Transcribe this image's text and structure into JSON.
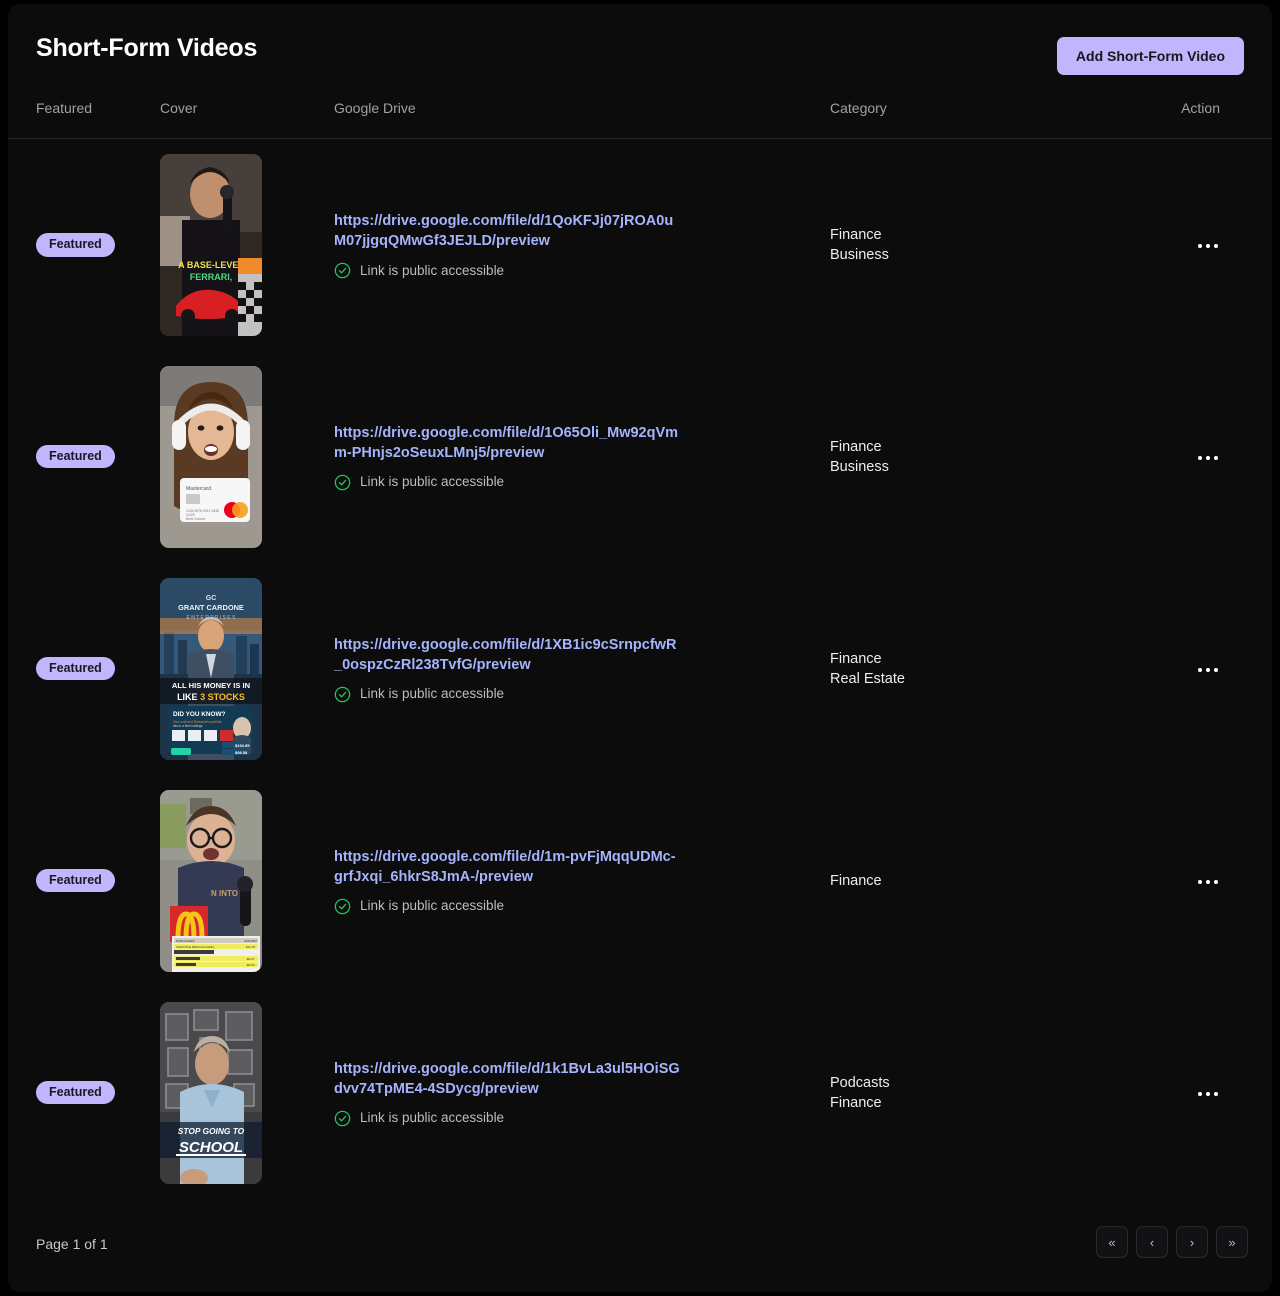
{
  "header": {
    "title": "Short-Form Videos",
    "add_button_label": "Add Short-Form Video"
  },
  "table": {
    "columns": {
      "featured": "Featured",
      "cover": "Cover",
      "drive": "Google Drive",
      "category": "Category",
      "action": "Action"
    },
    "rows": [
      {
        "featured_label": "Featured",
        "cover_alt": "man-with-microphone-and-red-ferrari-thumbnail",
        "drive_url": "https://drive.google.com/file/d/1QoKFJj07jROA0uM07jjgqQMwGf3JEJLD/preview",
        "link_status": "Link is public accessible",
        "categories": [
          "Finance",
          "Business"
        ]
      },
      {
        "featured_label": "Featured",
        "cover_alt": "woman-with-headphones-and-mastercard-thumbnail",
        "drive_url": "https://drive.google.com/file/d/1O65Oli_Mw92qVmm-PHnjs2oSeuxLMnj5/preview",
        "link_status": "Link is public accessible",
        "categories": [
          "Finance",
          "Business"
        ]
      },
      {
        "featured_label": "Featured",
        "cover_alt": "grant-cardone-enterprises-3-stocks-thumbnail",
        "drive_url": "https://drive.google.com/file/d/1XB1ic9cSrnpcfwR_0ospzCzRl238TvfG/preview",
        "link_status": "Link is public accessible",
        "categories": [
          "Finance",
          "Real Estate"
        ]
      },
      {
        "featured_label": "Featured",
        "cover_alt": "man-with-glasses-and-mcdonalds-receipt-thumbnail",
        "drive_url": "https://drive.google.com/file/d/1m-pvFjMqqUDMc-grfJxqi_6hkrS8JmA-/preview",
        "link_status": "Link is public accessible",
        "categories": [
          "Finance"
        ]
      },
      {
        "featured_label": "Featured",
        "cover_alt": "stop-going-to-school-thumbnail",
        "drive_url": "https://drive.google.com/file/d/1k1BvLa3ul5HOiSGdvv74TpME4-4SDycg/preview",
        "link_status": "Link is public accessible",
        "categories": [
          "Podcasts",
          "Finance"
        ]
      }
    ]
  },
  "pagination": {
    "status": "Page 1 of 1",
    "first_label": "«",
    "prev_label": "‹",
    "next_label": "›",
    "last_label": "»"
  },
  "colors": {
    "accent": "#c3b5fd",
    "link": "#a5b4fc",
    "success": "#22c55e",
    "background": "#0c0c0d"
  }
}
